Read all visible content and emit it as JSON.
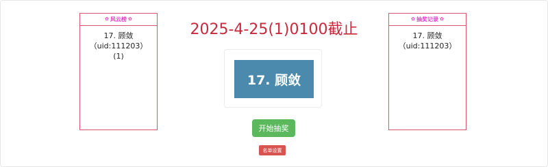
{
  "left_panel": {
    "title": "风云榜",
    "ornament": "✿",
    "entry_line1": "17. 顾敛（uid:111203）",
    "entry_line2": "(1)"
  },
  "right_panel": {
    "title": "抽奖记录",
    "ornament": "✿",
    "entry_line1": "17. 顾敛（uid:111203）"
  },
  "deadline": "2025-4-25(1)0100截止",
  "result": "17. 顾敛",
  "buttons": {
    "start": "开始抽奖",
    "list_settings": "名单设置"
  },
  "colors": {
    "panel_border": "#d9546b",
    "panel_title": "#e040c8",
    "deadline": "#c8283c",
    "result_bg": "#4b8aad",
    "start_btn": "#5cb85c",
    "list_btn": "#d9534f"
  }
}
